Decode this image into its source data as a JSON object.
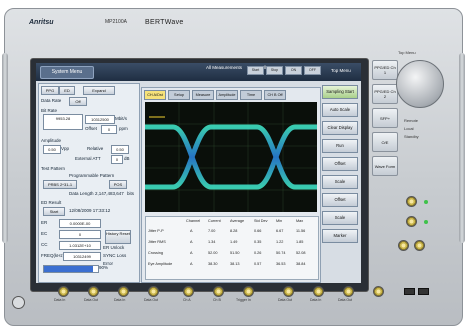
{
  "device": {
    "brand": "Anritsu",
    "model": "MP2100A",
    "product": "BERTWave"
  },
  "topbar": {
    "system_menu": "System Menu",
    "all_measurements": "All Measurements",
    "all_outputs": "All Outputs",
    "buttons": [
      "Start",
      "Stop",
      "ON",
      "OFF"
    ],
    "top_menu": "Top Menu"
  },
  "left_panel": {
    "tab1": "PPG",
    "tab2": "ED",
    "expand": "Expand",
    "data_rate_label": "Data Rate",
    "data_rate_btn": "Off",
    "bit_rate_label": "Bit Rate",
    "bit_rate_value": "9953.28",
    "bit_rate_sel": "10312500",
    "bit_rate_unit": "Mbit/s",
    "offset_label": "Offset",
    "offset_value": "0",
    "offset_unit": "ppm",
    "amplitude_label": "Amplitude",
    "amp_value": "0.50",
    "amp_unit": "Vpp",
    "relative_label": "Relative",
    "relative_value": "0.50",
    "external_att_label": "External ATT",
    "external_att_value": "0",
    "external_att_unit": "dB",
    "test_pattern_label": "Test Pattern",
    "programmable_pattern": "Programmable Pattern",
    "prbs": "PRBS 2^31-1",
    "pos": "POS",
    "data_length_label": "Data Length",
    "data_length_value": "2,147,483,647",
    "data_length_unit": "bits",
    "ed_result_label": "ED Result",
    "start_label": "Start",
    "start_time": "12/08/2009 17:33:12",
    "er_label": "ER",
    "er_value": "0.0000E-00",
    "ec_label": "EC",
    "ec_value": "0",
    "cc_label": "CC",
    "cc_value": "1.0312E+10",
    "freq_label": "FREQ(kHz)",
    "freq_value": "10312499",
    "history_reset": "History Reset",
    "er_unlock": "ER Unlock",
    "sync_loss": "SYNC Loss",
    "error_label": "Error",
    "progress_label": "90%",
    "progress": 0.9
  },
  "graph": {
    "tabs": [
      "CH A/Dst",
      "Setup",
      "Measure",
      "Amplitude",
      "Time",
      "CH B Off"
    ],
    "active_tab": 0,
    "stats_headers": [
      "Channel",
      "Current",
      "Average",
      "Std Dev",
      "Min",
      "Max"
    ],
    "stats_rows": [
      [
        "Jitter P-P",
        "A",
        "7.00",
        "8.28",
        "0.66",
        "6.67",
        "11.56"
      ],
      [
        "Jitter RMS",
        "A",
        "1.34",
        "1.49",
        "0.35",
        "1.22",
        "1.85"
      ],
      [
        "Crossing",
        "A",
        "52.00",
        "51.50",
        "0.26",
        "50.74",
        "52.08"
      ],
      [
        "Eye Amplitude",
        "A",
        "38.30",
        "38.13",
        "0.57",
        "36.53",
        "38.84"
      ]
    ]
  },
  "right_panel": {
    "buttons": [
      "Sampling Start",
      "Auto Scale",
      "Clear Display",
      "Run",
      "Offset",
      "Scale",
      "Offset",
      "Scale",
      "Marker"
    ]
  },
  "side_buttons": [
    "PPG/ED Ch 1",
    "PPG/ED Ch 2",
    "SFP+",
    "O/E",
    "Wave Form"
  ],
  "right_labels": {
    "top_menu": "Top Menu",
    "remote": "Remote",
    "local": "Local",
    "standby": "Standby"
  },
  "bottom_labels": [
    "Data In",
    "Data Out",
    "Data In",
    "Data Out",
    "Ch A",
    "Ch B",
    "Trigger In",
    "Data Out",
    "Data In",
    "Data Out"
  ]
}
